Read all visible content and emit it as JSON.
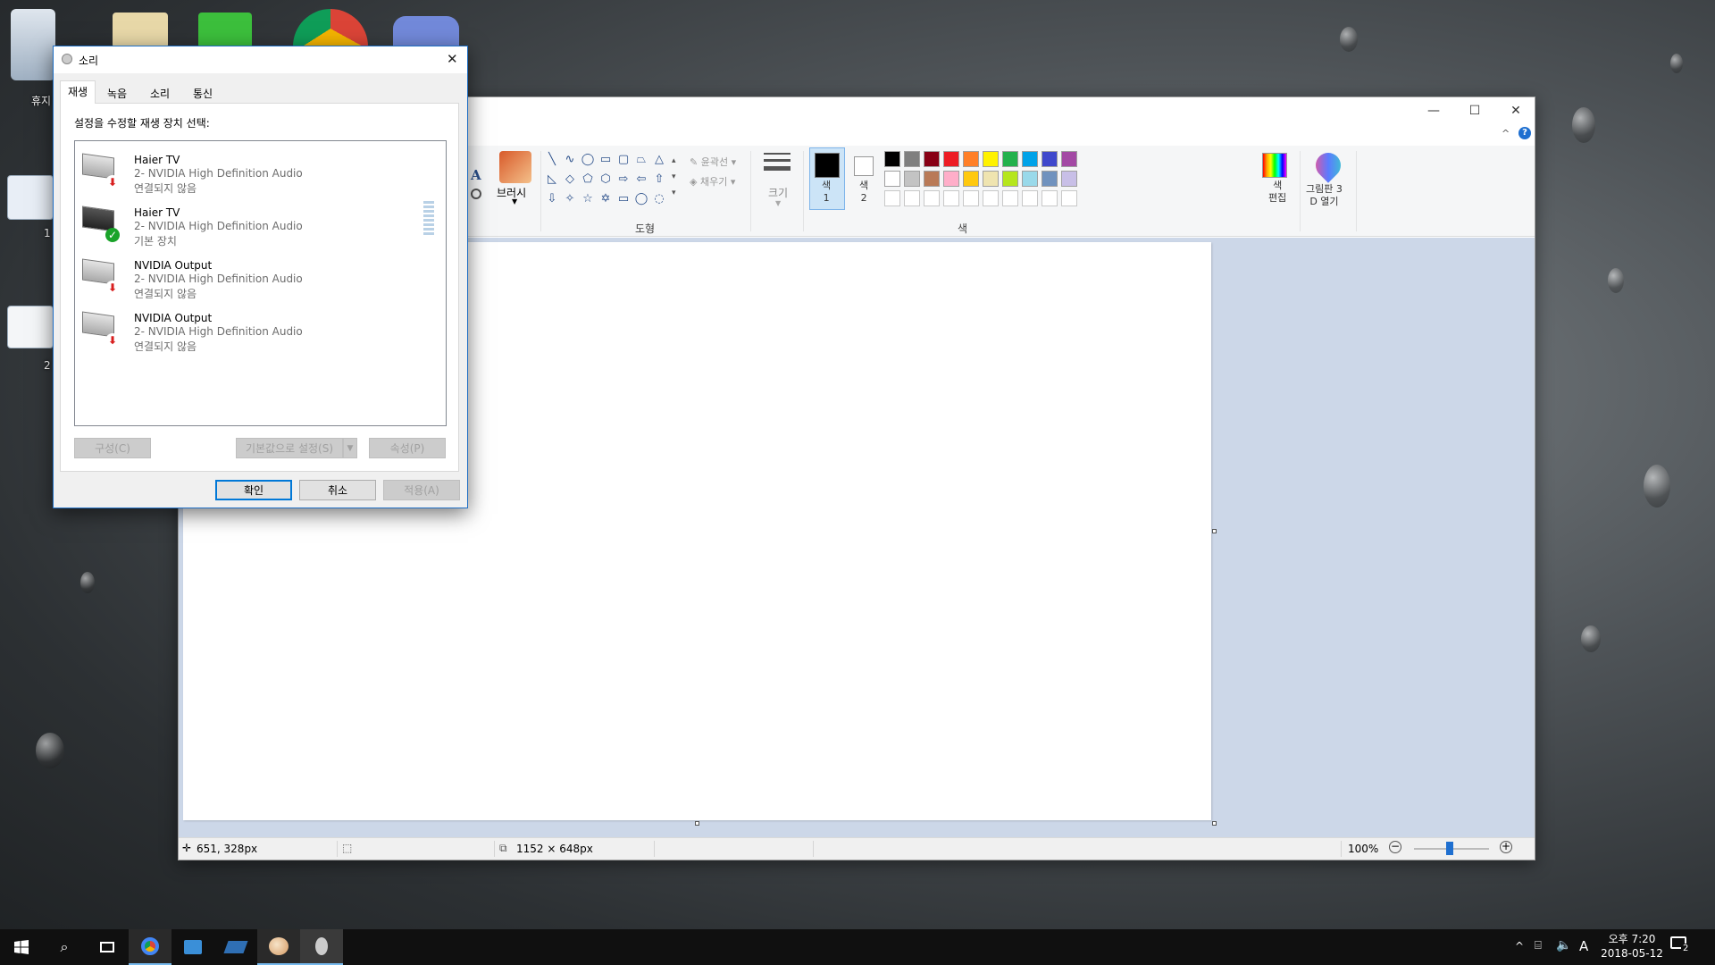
{
  "desktop": {
    "icons": [
      {
        "label": "휴지"
      },
      {
        "label": "1"
      },
      {
        "label": "2"
      }
    ]
  },
  "paint": {
    "window_controls": {
      "minimize": "—",
      "maximize": "☐",
      "close": "✕"
    },
    "ribbon": {
      "brush_label": "브러시",
      "outline_label": "윤곽선",
      "fill_label": "채우기",
      "shapes_group": "도형",
      "size_label": "크기",
      "color1_label": "색\n1",
      "color2_label": "색\n2",
      "edit_colors_label": "색\n편집",
      "paint3d_label": "그림판 3\nD 열기",
      "colors_group": "색",
      "palette_row1": [
        "#000000",
        "#7f7f7f",
        "#880015",
        "#ed1c24",
        "#ff7f27",
        "#fff200",
        "#22b14c",
        "#00a2e8",
        "#3f48cc",
        "#a349a4"
      ],
      "palette_row2": [
        "#ffffff",
        "#c3c3c3",
        "#b97a57",
        "#ffaec9",
        "#ffc90e",
        "#efe4b0",
        "#b5e61d",
        "#99d9ea",
        "#7092be",
        "#c8bfe7"
      ]
    },
    "status": {
      "cursor_pos": "651, 328px",
      "canvas_size": "1152 × 648px",
      "zoom": "100%"
    }
  },
  "sound_dialog": {
    "title": "소리",
    "tabs": [
      "재생",
      "녹음",
      "소리",
      "통신"
    ],
    "instruction": "설정을 수정할 재생 장치 선택:",
    "devices": [
      {
        "name": "Haier TV",
        "driver": "2- NVIDIA High Definition Audio",
        "status": "연결되지 않음",
        "state": "disconnected"
      },
      {
        "name": "Haier TV",
        "driver": "2- NVIDIA High Definition Audio",
        "status": "기본 장치",
        "state": "default"
      },
      {
        "name": "NVIDIA Output",
        "driver": "2- NVIDIA High Definition Audio",
        "status": "연결되지 않음",
        "state": "disconnected"
      },
      {
        "name": "NVIDIA Output",
        "driver": "2- NVIDIA High Definition Audio",
        "status": "연결되지 않음",
        "state": "disconnected"
      }
    ],
    "buttons": {
      "configure": "구성(C)",
      "set_default": "기본값으로 설정(S)",
      "properties": "속성(P)",
      "ok": "확인",
      "cancel": "취소",
      "apply": "적용(A)"
    }
  },
  "taskbar": {
    "clock_time": "오후 7:20",
    "clock_date": "2018-05-12",
    "ime": "A",
    "notification_count": "2"
  }
}
